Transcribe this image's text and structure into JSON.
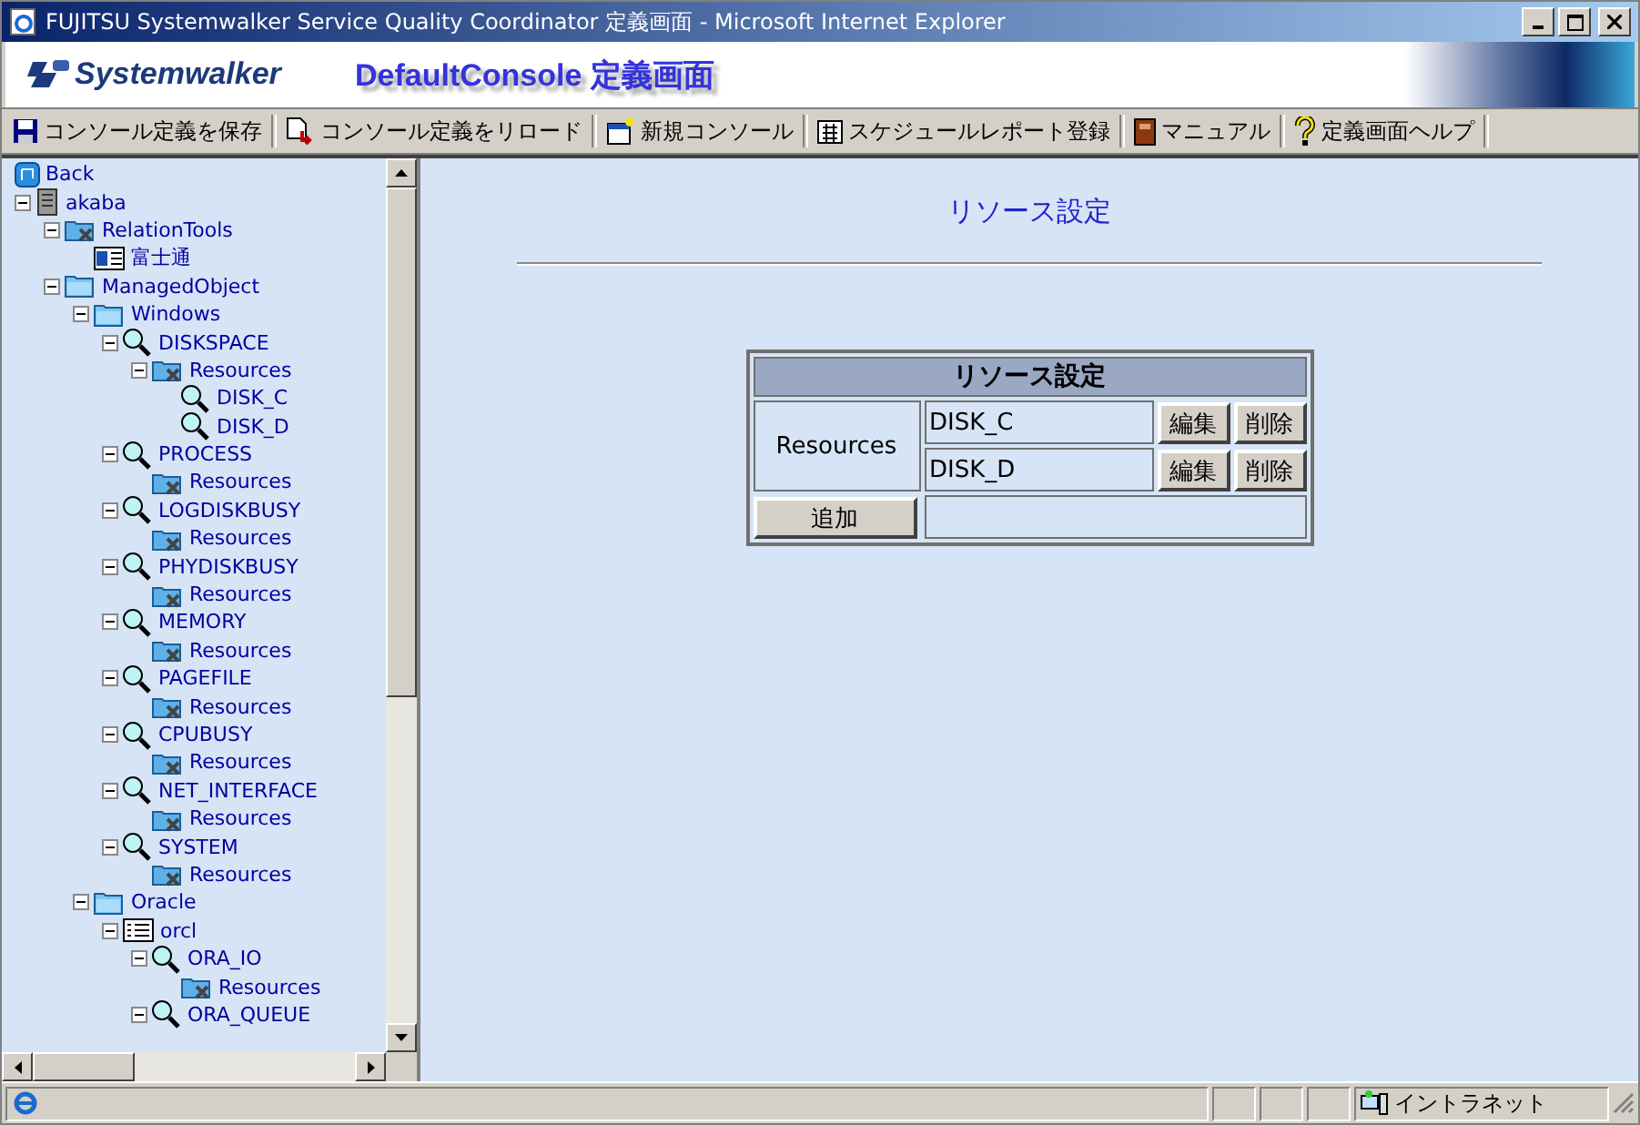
{
  "window": {
    "title": "FUJITSU Systemwalker Service Quality Coordinator 定義画面 - Microsoft Internet Explorer"
  },
  "banner": {
    "logo": "Systemwalker",
    "heading": "DefaultConsole 定義画面"
  },
  "toolbar": [
    {
      "kind": "save",
      "label": "コンソール定義を保存"
    },
    {
      "kind": "reload",
      "label": "コンソール定義をリロード"
    },
    {
      "kind": "new",
      "label": "新規コンソール"
    },
    {
      "kind": "schedule",
      "label": "スケジュールレポート登録"
    },
    {
      "kind": "manual",
      "label": "マニュアル"
    },
    {
      "kind": "help",
      "label": "定義画面ヘルプ"
    }
  ],
  "tree": {
    "back": "Back",
    "nodes": [
      {
        "label": "akaba",
        "kind": "server",
        "expanded": true,
        "children": [
          {
            "label": "RelationTools",
            "kind": "tool-folder",
            "expanded": true,
            "children": [
              {
                "label": "富士通",
                "kind": "panel"
              }
            ]
          },
          {
            "label": "ManagedObject",
            "kind": "folder",
            "expanded": true,
            "children": [
              {
                "label": "Windows",
                "kind": "folder",
                "expanded": true,
                "children": [
                  {
                    "label": "DISKSPACE",
                    "kind": "search",
                    "expanded": true,
                    "children": [
                      {
                        "label": "Resources",
                        "kind": "tool-folder",
                        "expanded": true,
                        "children": [
                          {
                            "label": "DISK_C",
                            "kind": "search"
                          },
                          {
                            "label": "DISK_D",
                            "kind": "search"
                          }
                        ]
                      }
                    ]
                  },
                  {
                    "label": "PROCESS",
                    "kind": "search",
                    "expanded": true,
                    "children": [
                      {
                        "label": "Resources",
                        "kind": "tool-folder"
                      }
                    ]
                  },
                  {
                    "label": "LOGDISKBUSY",
                    "kind": "search",
                    "expanded": true,
                    "children": [
                      {
                        "label": "Resources",
                        "kind": "tool-folder"
                      }
                    ]
                  },
                  {
                    "label": "PHYDISKBUSY",
                    "kind": "search",
                    "expanded": true,
                    "children": [
                      {
                        "label": "Resources",
                        "kind": "tool-folder"
                      }
                    ]
                  },
                  {
                    "label": "MEMORY",
                    "kind": "search",
                    "expanded": true,
                    "children": [
                      {
                        "label": "Resources",
                        "kind": "tool-folder"
                      }
                    ]
                  },
                  {
                    "label": "PAGEFILE",
                    "kind": "search",
                    "expanded": true,
                    "children": [
                      {
                        "label": "Resources",
                        "kind": "tool-folder"
                      }
                    ]
                  },
                  {
                    "label": "CPUBUSY",
                    "kind": "search",
                    "expanded": true,
                    "children": [
                      {
                        "label": "Resources",
                        "kind": "tool-folder"
                      }
                    ]
                  },
                  {
                    "label": "NET_INTERFACE",
                    "kind": "search",
                    "expanded": true,
                    "children": [
                      {
                        "label": "Resources",
                        "kind": "tool-folder"
                      }
                    ]
                  },
                  {
                    "label": "SYSTEM",
                    "kind": "search",
                    "expanded": true,
                    "children": [
                      {
                        "label": "Resources",
                        "kind": "tool-folder"
                      }
                    ]
                  }
                ]
              },
              {
                "label": "Oracle",
                "kind": "folder",
                "expanded": true,
                "children": [
                  {
                    "label": "orcl",
                    "kind": "list",
                    "expanded": true,
                    "children": [
                      {
                        "label": "ORA_IO",
                        "kind": "search",
                        "expanded": true,
                        "children": [
                          {
                            "label": "Resources",
                            "kind": "tool-folder"
                          }
                        ]
                      },
                      {
                        "label": "ORA_QUEUE",
                        "kind": "search",
                        "expanded": true
                      }
                    ]
                  }
                ]
              }
            ]
          }
        ]
      }
    ]
  },
  "main": {
    "title": "リソース設定",
    "table": {
      "title": "リソース設定",
      "group": "Resources",
      "rows": [
        {
          "value": "DISK_C",
          "edit": "編集",
          "delete": "削除"
        },
        {
          "value": "DISK_D",
          "edit": "編集",
          "delete": "削除"
        }
      ],
      "add": "追加"
    }
  },
  "status_bar": {
    "zone": "イントラネット"
  }
}
